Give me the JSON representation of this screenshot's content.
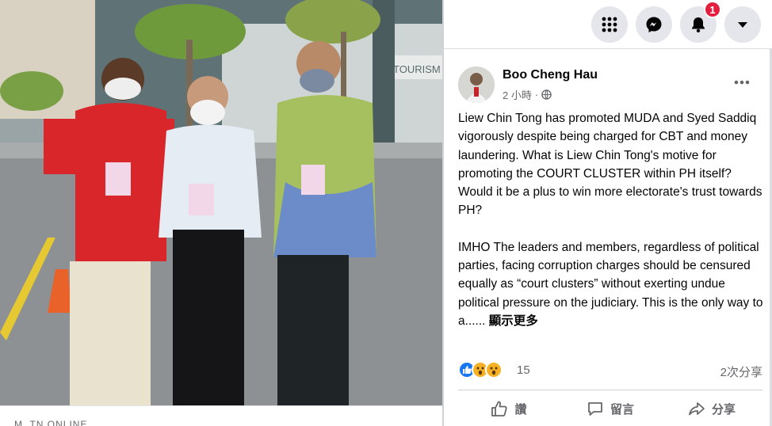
{
  "photo": {
    "caption_fragment": "M. TN ONLINE",
    "alt": "Three men standing outside a building wearing face masks and lanyards"
  },
  "topbar": {
    "menu_icon": "grid-menu-icon",
    "messenger_icon": "messenger-icon",
    "notifications_icon": "bell-icon",
    "notifications_badge": "1",
    "account_icon": "caret-down-icon"
  },
  "post": {
    "author": "Boo Cheng Hau",
    "time": "2 小時",
    "separator": "·",
    "privacy_icon": "globe-icon",
    "paragraphs": [
      "Liew Chin Tong has promoted MUDA and Syed Saddiq vigorously despite being charged for CBT and money laundering. What is Liew Chin Tong's motive for promoting the COURT CLUSTER within PH itself? Would it be a plus to win more electorate's trust towards PH?",
      "IMHO The leaders and members, regardless of political parties, facing corruption charges should be censured equally as “court clusters” without exerting undue political pressure on the judiciary. This is the only way to a......"
    ],
    "see_more": "顯示更多",
    "reactions": {
      "icons": [
        "like-icon",
        "wow-icon",
        "wow-icon"
      ],
      "count": "15"
    },
    "shares": "2次分享",
    "actions": {
      "like": "讚",
      "comment": "留言",
      "share": "分享"
    }
  },
  "colors": {
    "brand_blue": "#1877f2",
    "badge_red": "#e41e3f",
    "secondary_text": "#65676b"
  }
}
